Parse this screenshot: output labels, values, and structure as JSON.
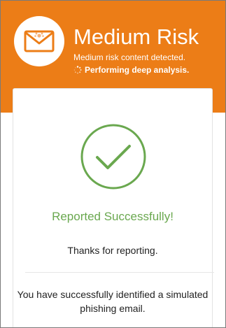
{
  "header": {
    "title": "Medium Risk",
    "subtitle": "Medium risk content detected.",
    "status": "Performing deep analysis.",
    "accent_color": "#ec7d17",
    "logo_icon": "envelope-icon"
  },
  "result": {
    "icon": "checkmark-circle-icon",
    "title": "Reported Successfully!",
    "title_color": "#6aa84f",
    "thanks": "Thanks for reporting.",
    "message": "You have successfully identified a simulated phishing email."
  }
}
